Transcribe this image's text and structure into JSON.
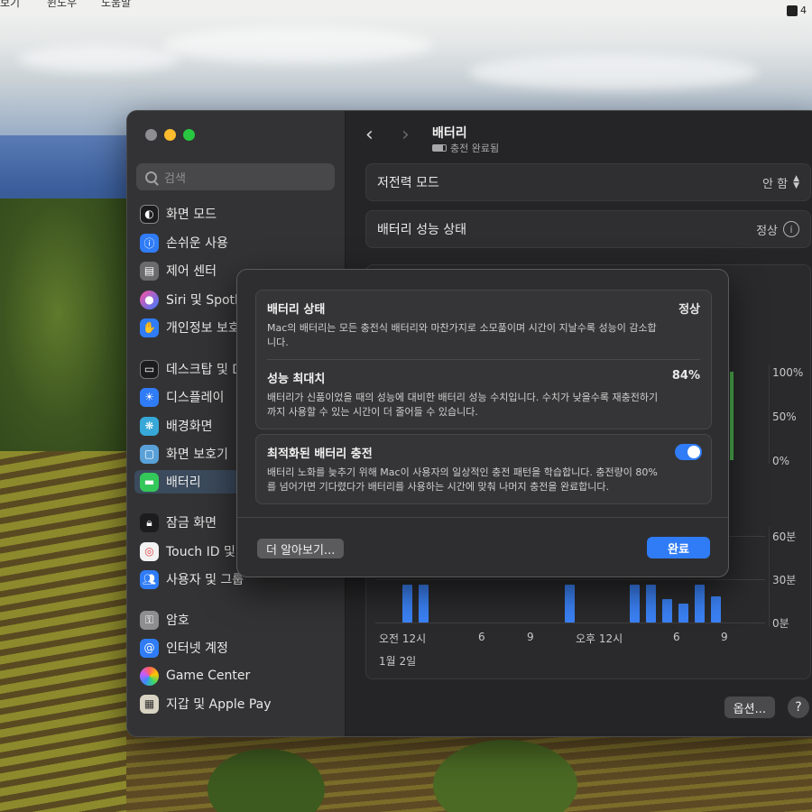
{
  "menubar": {
    "items": [
      "보기",
      "윈도우",
      "도움말"
    ],
    "status_number": "4"
  },
  "search": {
    "placeholder": "검색"
  },
  "sidebar": {
    "items": [
      {
        "label": "화면 모드",
        "icon": "appearance-icon",
        "color": "#2c2c2e"
      },
      {
        "label": "손쉬운 사용",
        "icon": "accessibility-icon",
        "color": "#2f7cf6"
      },
      {
        "label": "제어 센터",
        "icon": "control-center-icon",
        "color": "#6b6b6e"
      },
      {
        "label": "Siri 및 Spotl",
        "icon": "siri-icon",
        "color": "#a24bd8"
      },
      {
        "label": "개인정보 보호",
        "icon": "privacy-hand-icon",
        "color": "#2f7cf6"
      },
      {
        "label": "데스크탑 및 D",
        "icon": "desktop-dock-icon",
        "color": "#2c2c2e"
      },
      {
        "label": "디스플레이",
        "icon": "display-icon",
        "color": "#2f7cf6"
      },
      {
        "label": "배경화면",
        "icon": "wallpaper-icon",
        "color": "#37a8d8"
      },
      {
        "label": "화면 보호기",
        "icon": "screensaver-icon",
        "color": "#5aa0d8"
      },
      {
        "label": "배터리",
        "icon": "battery-icon",
        "color": "#34c759"
      },
      {
        "label": "잠금 화면",
        "icon": "lock-icon",
        "color": "#2c2c2e"
      },
      {
        "label": "Touch ID 및",
        "icon": "fingerprint-icon",
        "color": "#e7e7e7"
      },
      {
        "label": "사용자 및 그룹",
        "icon": "users-icon",
        "color": "#2f7cf6"
      },
      {
        "label": "암호",
        "icon": "key-icon",
        "color": "#8e8e90"
      },
      {
        "label": "인터넷 계정",
        "icon": "at-icon",
        "color": "#2f7cf6"
      },
      {
        "label": "Game Center",
        "icon": "game-center-icon",
        "color": "#e7e7e7"
      },
      {
        "label": "지갑 및 Apple Pay",
        "icon": "wallet-icon",
        "color": "#3a3a3c"
      }
    ]
  },
  "header": {
    "title": "배터리",
    "subtitle": "충전 완료됨"
  },
  "settings": {
    "low_power_label": "저전력 모드",
    "low_power_value": "안 함",
    "health_label": "배터리 성능 상태",
    "health_value": "정상"
  },
  "chart_data": {
    "type": "bar",
    "title": "",
    "y_ticks_level": [
      "100%",
      "50%",
      "0%"
    ],
    "y_ticks_usage": [
      "60분",
      "30분",
      "0분"
    ],
    "x_ticks": [
      "오전 12시",
      "6",
      "9",
      "오후 12시",
      "6",
      "9"
    ],
    "date_label": "1월 2일",
    "values": [
      26,
      26,
      0,
      0,
      0,
      0,
      0,
      0,
      0,
      0,
      26,
      0,
      0,
      0,
      26,
      26,
      16,
      13,
      26,
      18
    ]
  },
  "footer": {
    "options": "옵션...",
    "help": "?"
  },
  "sheet": {
    "sections": [
      {
        "title": "배터리 상태",
        "value": "정상",
        "desc": "Mac의 배터리는 모든 충전식 배터리와 마찬가지로 소모품이며 시간이 지날수록 성능이 감소합니다."
      },
      {
        "title": "성능 최대치",
        "value": "84%",
        "desc": "배터리가 신품이었을 때의 성능에 대비한 배터리 성능 수치입니다. 수치가 낮을수록 재충전하기까지 사용할 수 있는 시간이 더 줄어들 수 있습니다."
      },
      {
        "title": "최적화된 배터리 충전",
        "toggle": true,
        "desc": "배터리 노화를 늦추기 위해 Mac이 사용자의 일상적인 충전 패턴을 학습합니다. 충전량이 80%를 넘어가면 기다렸다가 배터리를 사용하는 시간에 맞춰 나머지 충전을 완료합니다."
      }
    ],
    "learn_more": "더 알아보기...",
    "done": "완료"
  }
}
